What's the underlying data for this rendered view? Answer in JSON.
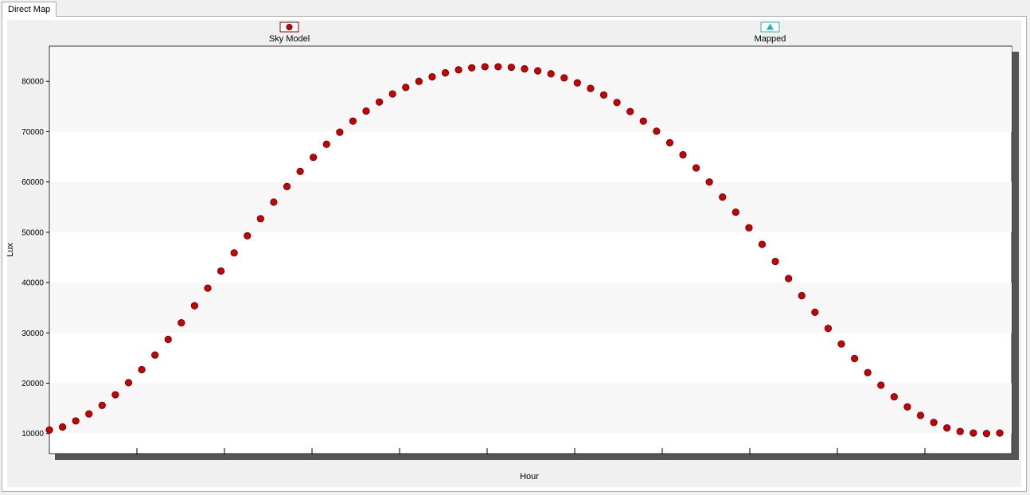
{
  "tab": {
    "label": "Direct Map"
  },
  "legend": [
    {
      "name": "Sky Model",
      "marker": "circle",
      "color": "#cc0000"
    },
    {
      "name": "Mapped",
      "marker": "triangle",
      "color": "#1fb8b0"
    }
  ],
  "chart_data": {
    "type": "scatter",
    "xlabel": "Hour",
    "ylabel": "Lux",
    "ylim": [
      6000,
      87000
    ],
    "yticks": [
      10000,
      20000,
      30000,
      40000,
      50000,
      60000,
      70000,
      80000
    ],
    "ytick_labels": [
      "10000",
      "20000",
      "30000",
      "40000",
      "50000",
      "60000",
      "70000",
      "80000"
    ],
    "x_tick_count": 10,
    "grid": "horizontal alternating bands",
    "legend_position": "top",
    "series": [
      {
        "name": "Sky Model",
        "color": "#cc0000",
        "values": [
          10700,
          11300,
          12500,
          13900,
          15600,
          17700,
          20100,
          22700,
          25600,
          28700,
          32000,
          35400,
          38900,
          42300,
          45900,
          49300,
          52700,
          56000,
          59100,
          62100,
          64900,
          67500,
          69900,
          72100,
          74100,
          75900,
          77500,
          78800,
          80000,
          80900,
          81700,
          82300,
          82700,
          82900,
          82900,
          82800,
          82500,
          82100,
          81500,
          80700,
          79700,
          78600,
          77300,
          75800,
          74000,
          72100,
          70100,
          67800,
          65400,
          62800,
          60000,
          57000,
          54000,
          50900,
          47600,
          44200,
          40800,
          37400,
          34100,
          30900,
          27800,
          24900,
          22100,
          19600,
          17300,
          15300,
          13600,
          12200,
          11100,
          10400,
          10100,
          10000,
          10100
        ]
      },
      {
        "name": "Mapped",
        "color": "#1fb8b0",
        "values": []
      }
    ]
  }
}
